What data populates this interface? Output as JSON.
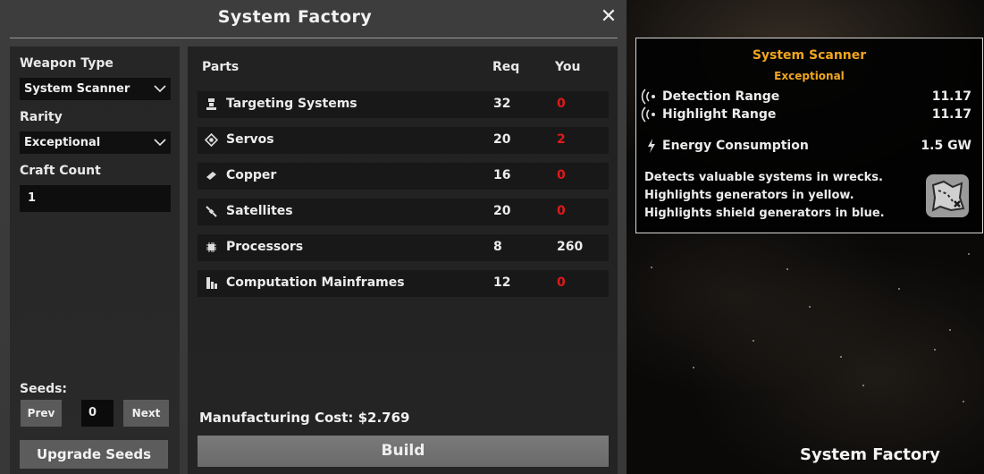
{
  "window": {
    "title": "System Factory",
    "close_label": "✕"
  },
  "left": {
    "weapon_type_label": "Weapon Type",
    "weapon_type_value": "System Scanner",
    "rarity_label": "Rarity",
    "rarity_value": "Exceptional",
    "craft_count_label": "Craft Count",
    "craft_count_value": "1",
    "seeds_label": "Seeds:",
    "prev_label": "Prev",
    "seed_value": "0",
    "next_label": "Next",
    "upgrade_label": "Upgrade Seeds"
  },
  "parts": {
    "headers": {
      "parts": "Parts",
      "req": "Req",
      "you": "You"
    },
    "rows": [
      {
        "icon": "targeting-icon",
        "name": "Targeting Systems",
        "req": "32",
        "you": "0",
        "status_color": "#e01a1a"
      },
      {
        "icon": "servos-icon",
        "name": "Servos",
        "req": "20",
        "you": "2",
        "status_color": "#e01a1a"
      },
      {
        "icon": "copper-icon",
        "name": "Copper",
        "req": "16",
        "you": "0",
        "status_color": "#e01a1a"
      },
      {
        "icon": "satellite-icon",
        "name": "Satellites",
        "req": "20",
        "you": "0",
        "status_color": "#e01a1a"
      },
      {
        "icon": "processor-icon",
        "name": "Processors",
        "req": "8",
        "you": "260",
        "status_color": "#ececec"
      },
      {
        "icon": "mainframe-icon",
        "name": "Computation Mainframes",
        "req": "12",
        "you": "0",
        "status_color": "#e01a1a"
      }
    ],
    "cost": "Manufacturing Cost: $2.769",
    "build_label": "Build"
  },
  "tooltip": {
    "title": "System Scanner",
    "rarity": "Exceptional",
    "accent_color": "#f0a620",
    "stats": [
      {
        "icon": "signal-icon",
        "name": "Detection Range",
        "value": "11.17"
      },
      {
        "icon": "signal-icon",
        "name": "Highlight Range",
        "value": "11.17"
      },
      {
        "icon": "lightning-icon",
        "name": "Energy Consumption",
        "value": "1.5 GW"
      }
    ],
    "description": [
      "Detects valuable systems in wrecks.",
      "Highlights generators in yellow.",
      "Highlights shield generators in blue."
    ]
  },
  "footer": {
    "brand": "System Factory"
  }
}
